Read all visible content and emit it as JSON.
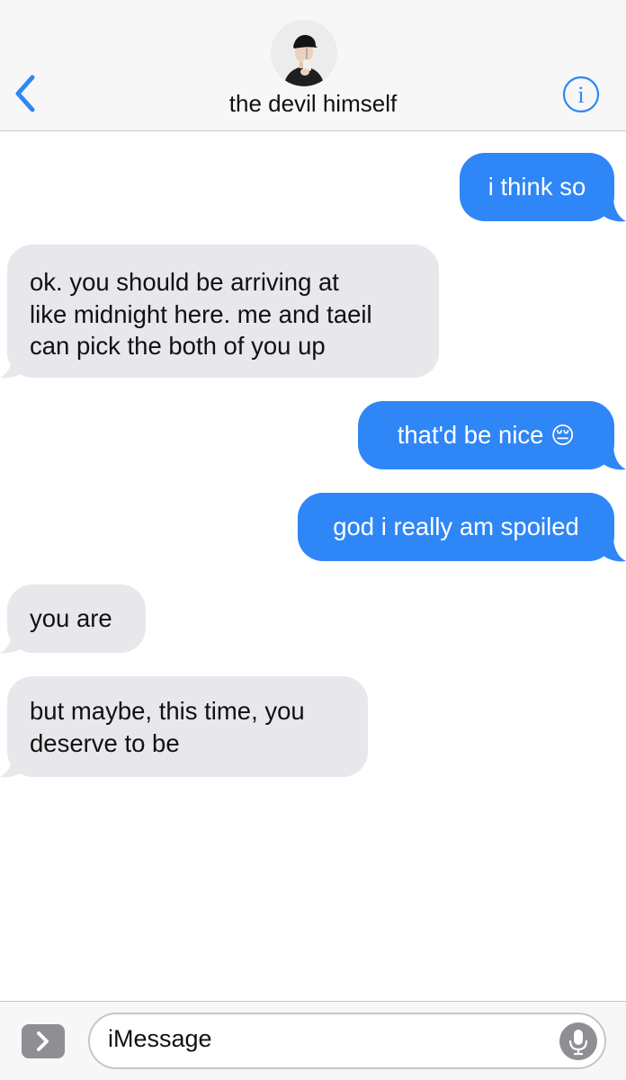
{
  "header": {
    "contact_name": "the devil himself",
    "back_icon": "chevron-left-icon",
    "info_icon": "info-icon",
    "accent_color": "#2f86f6"
  },
  "messages": [
    {
      "direction": "outgoing",
      "text": "i think so"
    },
    {
      "direction": "incoming",
      "lines": [
        "ok. you should be arriving at",
        "like midnight here. me and taeil",
        "can pick the both of you up"
      ]
    },
    {
      "direction": "outgoing",
      "text": "that'd be nice",
      "emoji": "😔"
    },
    {
      "direction": "outgoing",
      "text": "god i really am spoiled"
    },
    {
      "direction": "incoming",
      "lines": [
        "you are"
      ]
    },
    {
      "direction": "incoming",
      "lines": [
        "but maybe, this time, you",
        "deserve to be"
      ]
    }
  ],
  "composer": {
    "placeholder": "iMessage",
    "apps_icon": "chevron-right-icon",
    "mic_icon": "microphone-icon"
  },
  "colors": {
    "outgoing_bubble": "#2f86f6",
    "incoming_bubble": "#e8e8ec"
  }
}
